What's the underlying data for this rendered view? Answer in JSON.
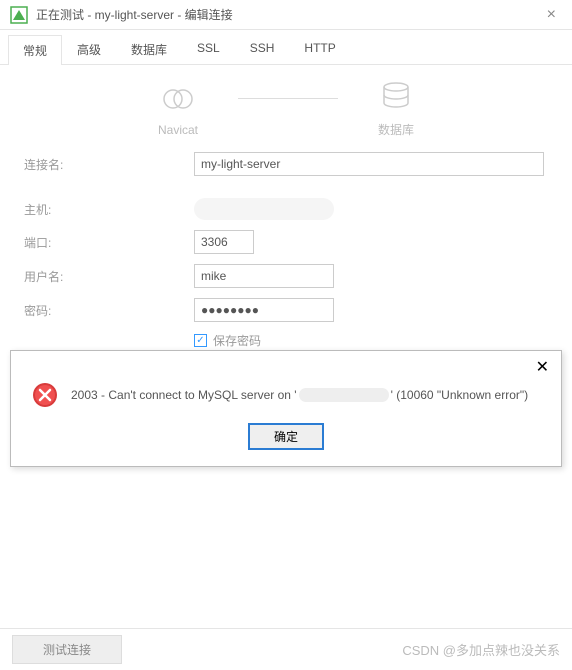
{
  "window": {
    "title": "正在测试 - my-light-server - 编辑连接"
  },
  "tabs": {
    "t0": "常规",
    "t1": "高级",
    "t2": "数据库",
    "t3": "SSL",
    "t4": "SSH",
    "t5": "HTTP"
  },
  "illustration": {
    "left": "Navicat",
    "right": "数据库"
  },
  "form": {
    "conn_name_label": "连接名:",
    "conn_name_value": "my-light-server",
    "host_label": "主机:",
    "port_label": "端口:",
    "port_value": "3306",
    "user_label": "用户名:",
    "user_value": "mike",
    "pass_label": "密码:",
    "pass_value": "●●●●●●●●",
    "save_pass_label": "保存密码"
  },
  "error": {
    "msg_prefix": "2003 - Can't connect to MySQL server on '",
    "msg_suffix": "' (10060 \"Unknown error\")",
    "ok": "确定"
  },
  "footer": {
    "test_btn": "测试连接",
    "watermark": "CSDN @多加点辣也没关系"
  }
}
